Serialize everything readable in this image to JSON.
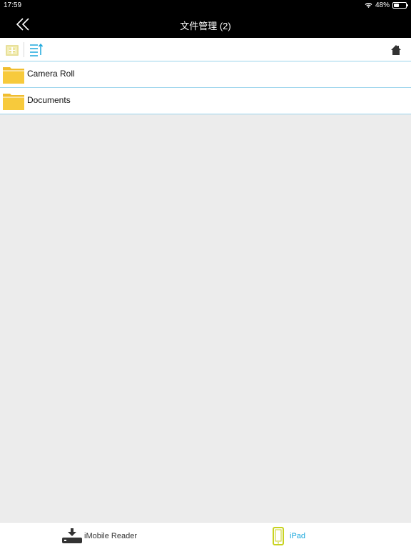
{
  "status": {
    "time": "17:59",
    "battery": "48%"
  },
  "nav": {
    "title": "文件管理 (2)",
    "back_icon": "double-chevron-left-icon"
  },
  "toolbar": {
    "icons": [
      "new-folder-icon",
      "sort-icon",
      "home-icon"
    ]
  },
  "files": [
    {
      "name": "Camera Roll",
      "icon": "folder-icon"
    },
    {
      "name": "Documents",
      "icon": "folder-icon"
    }
  ],
  "tabs": [
    {
      "label": "iMobile Reader",
      "icon": "download-device-icon",
      "selected": false
    },
    {
      "label": "iPad",
      "icon": "ipad-icon",
      "selected": true
    }
  ],
  "colors": {
    "accent": "#1aa7dc",
    "folder": "#f7ca3c",
    "tab_icon_selected": "#c8d21f"
  }
}
